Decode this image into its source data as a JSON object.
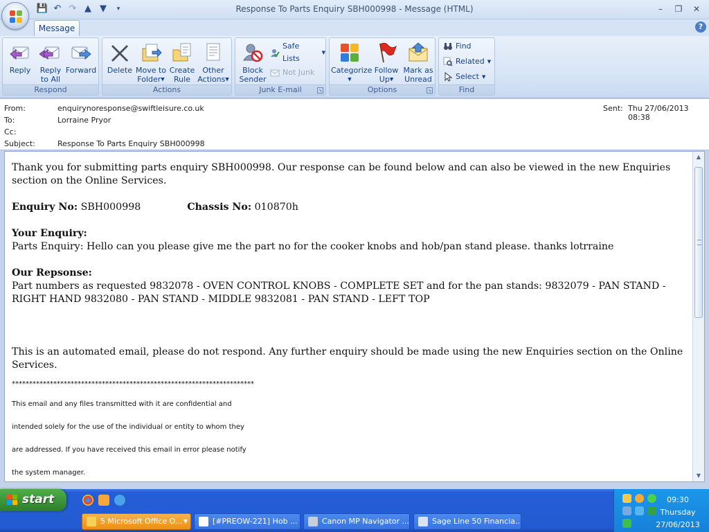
{
  "window": {
    "title": "Response To Parts Enquiry SBH000998 - Message (HTML)",
    "minimize": "–",
    "restore": "❐",
    "close": "✕"
  },
  "quick_access": [
    "save-icon",
    "undo-icon",
    "redo-icon",
    "previous-icon",
    "next-icon",
    "customize-icon"
  ],
  "ribbon": {
    "tab": "Message",
    "help": "?",
    "groups": {
      "respond": {
        "label": "Respond",
        "reply": "Reply",
        "reply_all_1": "Reply",
        "reply_all_2": "to All",
        "forward": "Forward"
      },
      "actions": {
        "label": "Actions",
        "delete": "Delete",
        "move_1": "Move to",
        "move_2": "Folder",
        "rule_1": "Create",
        "rule_2": "Rule",
        "other_1": "Other",
        "other_2": "Actions"
      },
      "junk": {
        "label": "Junk E-mail",
        "block_1": "Block",
        "block_2": "Sender",
        "safe_lists": "Safe Lists",
        "not_junk": "Not Junk"
      },
      "options": {
        "label": "Options",
        "categorize": "Categorize",
        "follow_1": "Follow",
        "follow_2": "Up",
        "mark_1": "Mark as",
        "mark_2": "Unread"
      },
      "find": {
        "label": "Find",
        "find": "Find",
        "related": "Related",
        "select": "Select"
      }
    }
  },
  "header": {
    "from_label": "From:",
    "from": "enquirynoresponse@swiftleisure.co.uk",
    "to_label": "To:",
    "to": "Lorraine Pryor",
    "cc_label": "Cc:",
    "cc": "",
    "subject_label": "Subject:",
    "subject": "Response To Parts Enquiry SBH000998",
    "sent_label": "Sent:",
    "sent": "Thu 27/06/2013 08:38"
  },
  "body": {
    "intro": "Thank you for submitting parts enquiry SBH000998. Our response can be found below and can also be viewed in the new Enquiries section on the Online Services.",
    "enquiry_no_label": "Enquiry No:",
    "enquiry_no": "SBH000998",
    "chassis_no_label": "Chassis No:",
    "chassis_no": "010870h",
    "your_enquiry_heading": "Your Enquiry:",
    "your_enquiry": "Parts Enquiry: Hello can you please give me the part no for the cooker knobs and hob/pan stand please. thanks lotrraine",
    "response_heading": "Our Repsonse:",
    "response": "Part numbers as requested 9832078 - OVEN CONTROL KNOBS - COMPLETE SET and for the pan stands: 9832079 - PAN STAND - RIGHT HAND 9832080 - PAN STAND - MIDDLE 9832081 - PAN STAND - LEFT TOP",
    "automated": "This is an automated email, please do not respond. Any further enquiry should be made using the new Enquiries section on the Online Services.",
    "separator": "**********************************************************************",
    "disclaimer_1": "This email and any files transmitted with it are confidential and",
    "disclaimer_2": "intended solely for the use of the individual or entity to whom they",
    "disclaimer_3": "are addressed. If you have received this email in error please notify",
    "disclaimer_4": "the system manager."
  },
  "taskbar": {
    "start": "start",
    "tasks": [
      {
        "label": "5 Microsoft Office O...",
        "active": true
      },
      {
        "label": "[#PREOW-221] Hob ...",
        "active": false
      },
      {
        "label": "Canon MP Navigator ...",
        "active": false
      },
      {
        "label": "Sage Line 50 Financia...",
        "active": false
      }
    ],
    "clock": {
      "time": "09:30",
      "day": "Thursday",
      "date": "27/06/2013"
    }
  }
}
